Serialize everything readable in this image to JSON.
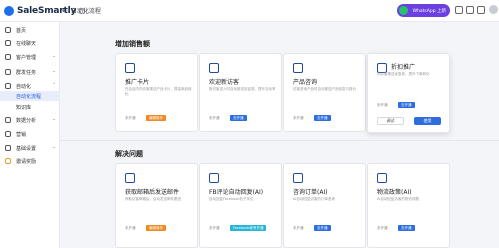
{
  "app": {
    "name": "SaleSmartly"
  },
  "breadcrumb": {
    "back_arrow": "←",
    "title": "自动化流程"
  },
  "header": {
    "whatsapp_label": "WhatsApp 上新",
    "icons": [
      "notification-icon",
      "help-icon",
      "settings-icon"
    ]
  },
  "sidebar": {
    "items": [
      {
        "label": "首页",
        "icon": "home-icon"
      },
      {
        "label": "在线聊天",
        "icon": "chat-icon"
      },
      {
        "label": "客户管理",
        "icon": "users-icon",
        "chevron": "⌄"
      },
      {
        "label": "群发任务",
        "icon": "broadcast-icon",
        "chevron": "⌄"
      },
      {
        "label": "自动化",
        "icon": "automation-icon",
        "chevron": "⌃"
      },
      {
        "label": "自动化流程",
        "sub": true,
        "active": true
      },
      {
        "label": "知识库",
        "sub": true
      },
      {
        "label": "数据分析",
        "icon": "chart-icon",
        "chevron": "⌄"
      },
      {
        "label": "营销",
        "icon": "megaphone-icon"
      },
      {
        "label": "基础设置",
        "icon": "gear-icon",
        "chevron": "⌄"
      },
      {
        "label": "邀请奖励",
        "icon": "gift-icon"
      }
    ]
  },
  "sections": [
    {
      "title": "增加销售额",
      "cards": [
        {
          "title": "推广卡片",
          "icon": "card-icon",
          "desc": "在会话内向访客推送产品卡片，提高商品转化",
          "status": "未开通",
          "tag": "编辑操作",
          "tag_color": "orange"
        },
        {
          "title": "欢迎新访客",
          "icon": "welcome-icon",
          "desc": "新访客进入时自动推送欢迎语，提升互动率",
          "status": "未开通",
          "tag": "去开通",
          "tag_color": "blue"
        },
        {
          "title": "产品咨询",
          "icon": "info-icon",
          "desc": "访客咨询产品时自动推送产品信息与报价",
          "status": "未开通",
          "tag": "去开通",
          "tag_color": "blue"
        },
        {
          "title": "折扣推广",
          "icon": "discount-icon",
          "desc": "向访客推送优惠券，提升下单转化",
          "status": "未开通",
          "tag": "去开通",
          "tag_color": "blue",
          "cancel": "调试",
          "use": "使用"
        }
      ]
    },
    {
      "title": "解决问题",
      "cards": [
        {
          "title": "获取邮箱后发送邮件",
          "icon": "email-icon",
          "desc": "获取访客邮箱后，自动发送邮件跟进",
          "status": "未开通",
          "tag": "编辑操作",
          "tag_color": "orange"
        },
        {
          "title": "FB评论自动回复(AI)",
          "icon": "comment-icon",
          "desc": "自动回复Facebook帖子评论",
          "status": "未开通",
          "tag": "Facebook帐号开通",
          "tag_color": "cyan"
        },
        {
          "title": "咨询订单(AI)",
          "icon": "order-icon",
          "desc": "AI自动回复访客的订单咨询",
          "status": "未开通",
          "tag": "去开通",
          "tag_color": "blue"
        },
        {
          "title": "物流政策(AI)",
          "icon": "truck-icon",
          "desc": "AI自动回复访客的物流问题",
          "status": "未开通",
          "tag": "去开通",
          "tag_color": "blue"
        }
      ]
    }
  ]
}
